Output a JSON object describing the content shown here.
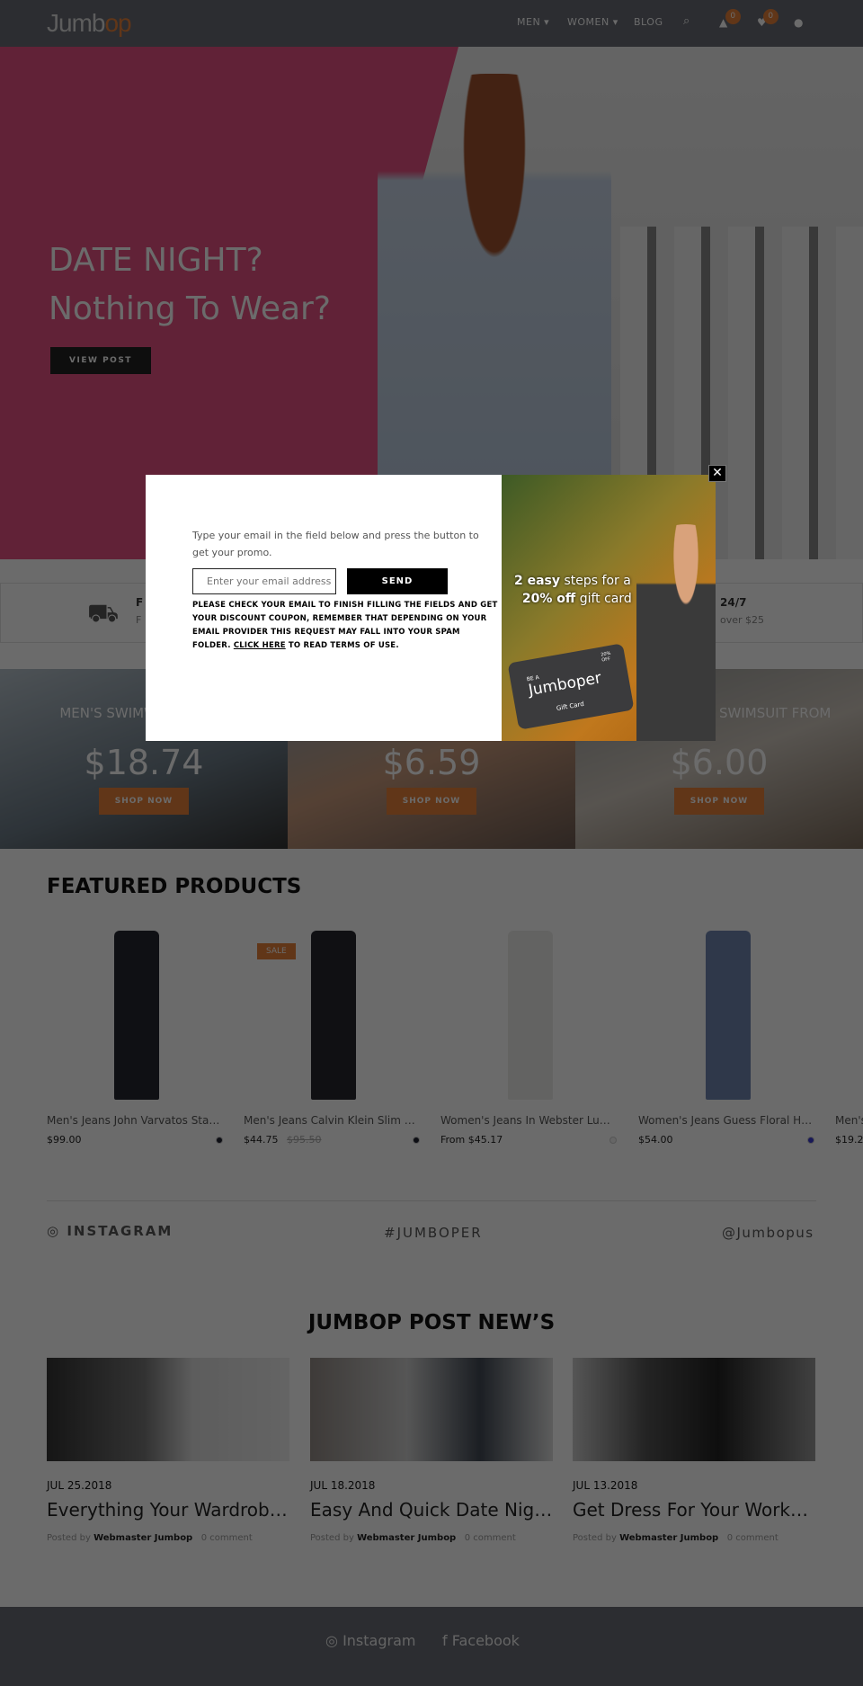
{
  "header": {
    "logo": "Jumbop",
    "nav": [
      "MEN",
      "WOMEN",
      "BLOG"
    ],
    "cart_count": "0",
    "wishlist_count": "0"
  },
  "hero": {
    "line1": "DATE NIGHT?",
    "line2": "Nothing To Wear?",
    "button": "VIEW POST",
    "accent": "#e65082"
  },
  "features": [
    {
      "title": "F",
      "sub": "F"
    },
    {
      "title": "24/7",
      "sub": "over $25"
    }
  ],
  "banners": [
    {
      "title": "MEN'S SWIMWEAR FROM",
      "price": "$18.74",
      "button": "SHOP NOW"
    },
    {
      "title": "",
      "price": "$6.59",
      "button": "SHOP NOW"
    },
    {
      "title": "SWIMSUIT FROM",
      "price": "$6.00",
      "button": "SHOP NOW"
    }
  ],
  "featured": {
    "title": "FEATURED PRODUCTS",
    "products": [
      {
        "name": "Men's Jeans John Varvatos Star ...",
        "price": "$99.00",
        "old": "",
        "badge": "",
        "color": "#1e2230"
      },
      {
        "name": "Men's Jeans Calvin Klein Slim Fit S...",
        "price": "$44.75",
        "old": "$95.50",
        "badge": "SALE",
        "color": "#1e2230"
      },
      {
        "name": "Women's Jeans In Webster Luck...",
        "price": "From $45.17",
        "old": "",
        "badge": "",
        "color": "#f2f2f2"
      },
      {
        "name": "Women's Jeans Guess Floral Hig...",
        "price": "$54.00",
        "old": "",
        "badge": "",
        "color": "#3a3ad0"
      },
      {
        "name": "Men's",
        "price": "$19.2",
        "old": "",
        "badge": "",
        "color": ""
      }
    ]
  },
  "instagram": {
    "label": "INSTAGRAM",
    "hashtag": "#JUMBOPER",
    "handle": "@Jumbopus"
  },
  "posts": {
    "title": "JUMBOP POST NEW’S",
    "items": [
      {
        "date": "JUL 25.2018",
        "title": "Everything Your Wardrobe ...",
        "by": "Posted by",
        "author": "Webmaster Jumbop",
        "comments": "0 comment"
      },
      {
        "date": "JUL 18.2018",
        "title": "Easy And Quick Date Night...",
        "by": "Posted by",
        "author": "Webmaster Jumbop",
        "comments": "0 comment"
      },
      {
        "date": "JUL 13.2018",
        "title": "Get Dress For Your Workpla...",
        "by": "Posted by",
        "author": "Webmaster Jumbop",
        "comments": "0 comment"
      }
    ]
  },
  "footer": {
    "links": [
      "Instagram",
      "Facebook"
    ]
  },
  "modal": {
    "text": "Type your email in the field below and press the button to get your promo.",
    "placeholder": "Enter your email address",
    "send": "SEND",
    "note_pre": "PLEASE CHECK YOUR EMAIL TO FINISH FILLING THE FIELDS AND GET YOUR DISCOUNT COUPON, REMEMBER THAT DEPENDING ON YOUR EMAIL PROVIDER THIS REQUEST MAY FALL INTO YOUR SPAM FOLDER.",
    "note_link": "CLICK HERE",
    "note_post": "TO READ TERMS OF USE.",
    "promo_l1a": "2 easy",
    "promo_l1b": "steps for a",
    "promo_l2a": "20% off",
    "promo_l2b": "gift card",
    "card_be": "BE A",
    "card_brand": "Jumboper",
    "card_label": "Gift Card",
    "card_off": "20% OFF"
  }
}
